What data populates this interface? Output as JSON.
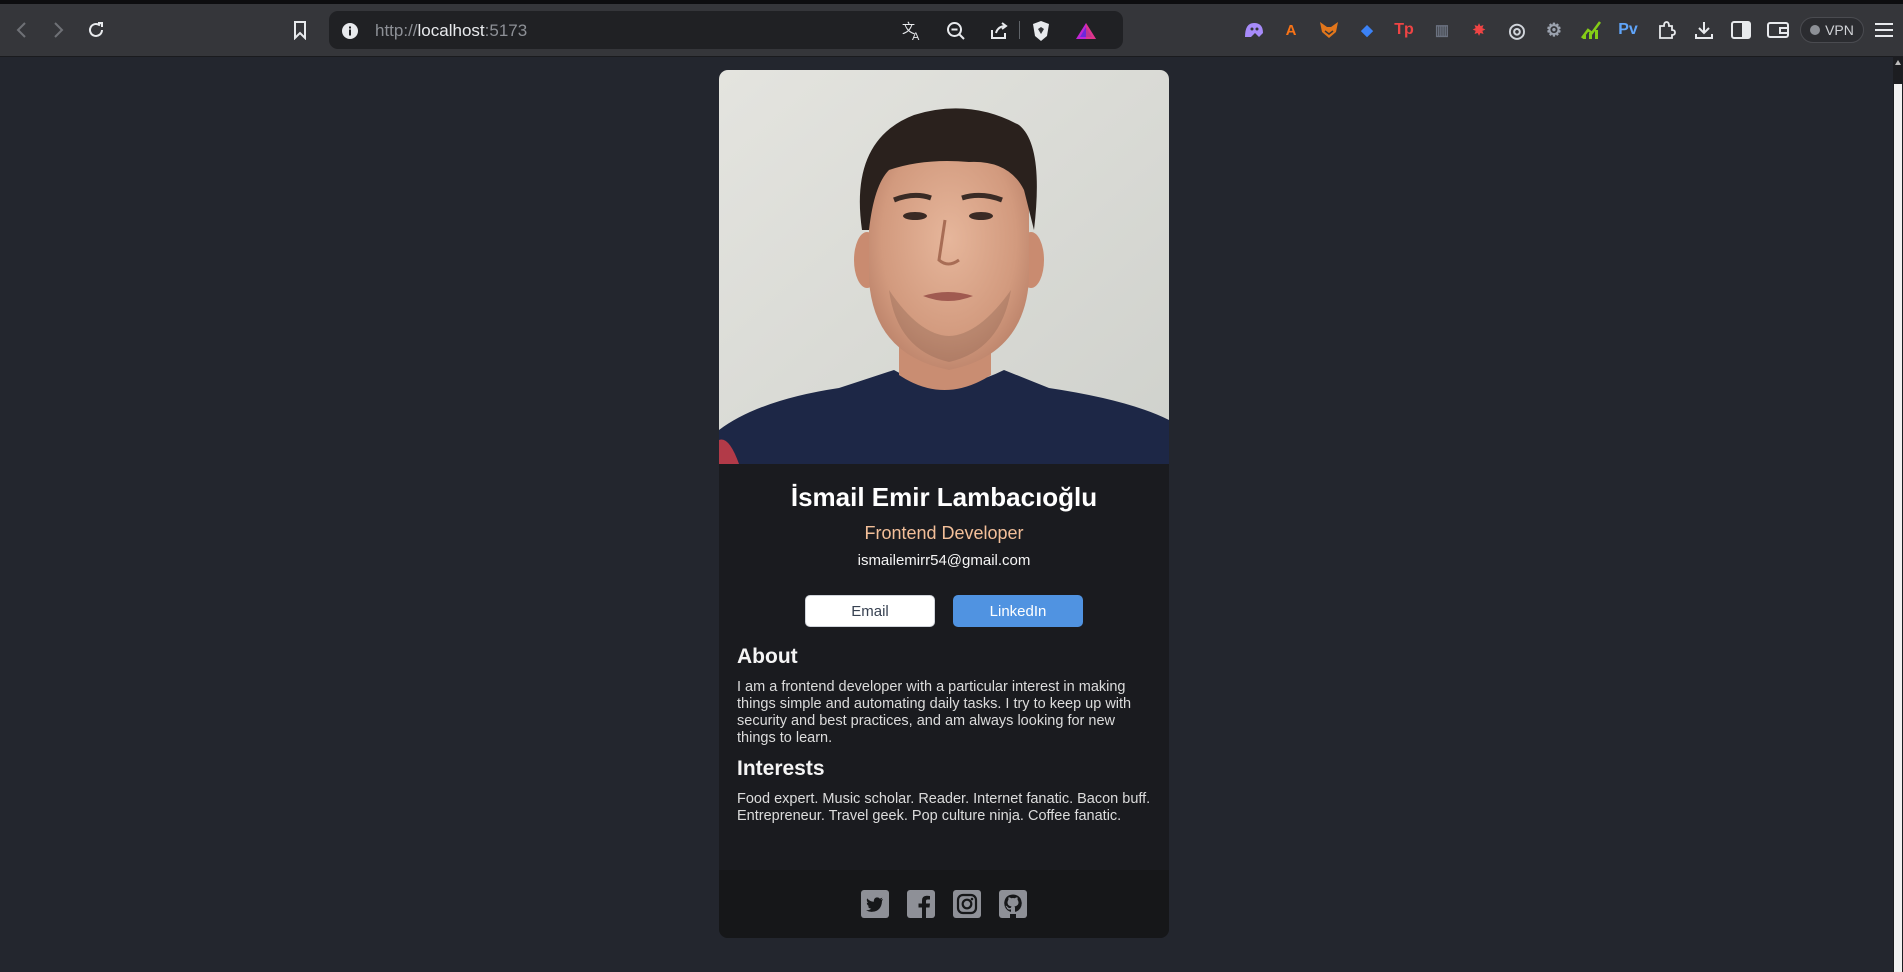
{
  "browser": {
    "url_scheme": "http://",
    "url_host": "localhost",
    "url_port": ":5173",
    "vpn_label": "VPN",
    "extensions": [
      {
        "name": "ghost-extension-icon",
        "glyph": "",
        "color": "#a78bfa"
      },
      {
        "name": "a-extension-icon",
        "glyph": "A",
        "color": "#f97316"
      },
      {
        "name": "fox-extension-icon",
        "glyph": "",
        "color": "#e2761b"
      },
      {
        "name": "diamond-extension-icon",
        "glyph": "◆",
        "color": "#3b82f6"
      },
      {
        "name": "tp-extension-icon",
        "glyph": "Tp",
        "color": "#ef4444"
      },
      {
        "name": "reader-extension-icon",
        "glyph": "▥",
        "color": "#6b7280"
      },
      {
        "name": "puzzle-red-extension-icon",
        "glyph": "✸",
        "color": "#ef4444"
      },
      {
        "name": "target-extension-icon",
        "glyph": "◎",
        "color": "#d1d5db"
      },
      {
        "name": "gear-extension-icon",
        "glyph": "⚙",
        "color": "#9ca3af"
      },
      {
        "name": "chart-extension-icon",
        "glyph": "",
        "color": "#84cc16"
      },
      {
        "name": "pv-extension-icon",
        "glyph": "Pv",
        "color": "#60a5fa"
      }
    ]
  },
  "profile": {
    "name": "İsmail Emir Lambacıoğlu",
    "role": "Frontend Developer",
    "email": "ismailemirr54@gmail.com",
    "buttons": {
      "email": "Email",
      "linkedin": "LinkedIn"
    },
    "about": {
      "title": "About",
      "text": "I am a frontend developer with a particular interest in making things simple and automating daily tasks. I try to keep up with security and best practices, and am always looking for new things to learn."
    },
    "interests": {
      "title": "Interests",
      "text": "Food expert. Music scholar. Reader. Internet fanatic. Bacon buff. Entrepreneur. Travel geek. Pop culture ninja. Coffee fanatic."
    }
  },
  "colors": {
    "page_bg": "#23262e",
    "card_bg": "#1a1b1f",
    "role_accent": "#f3bf99",
    "linkedin_btn": "#5093e1"
  }
}
